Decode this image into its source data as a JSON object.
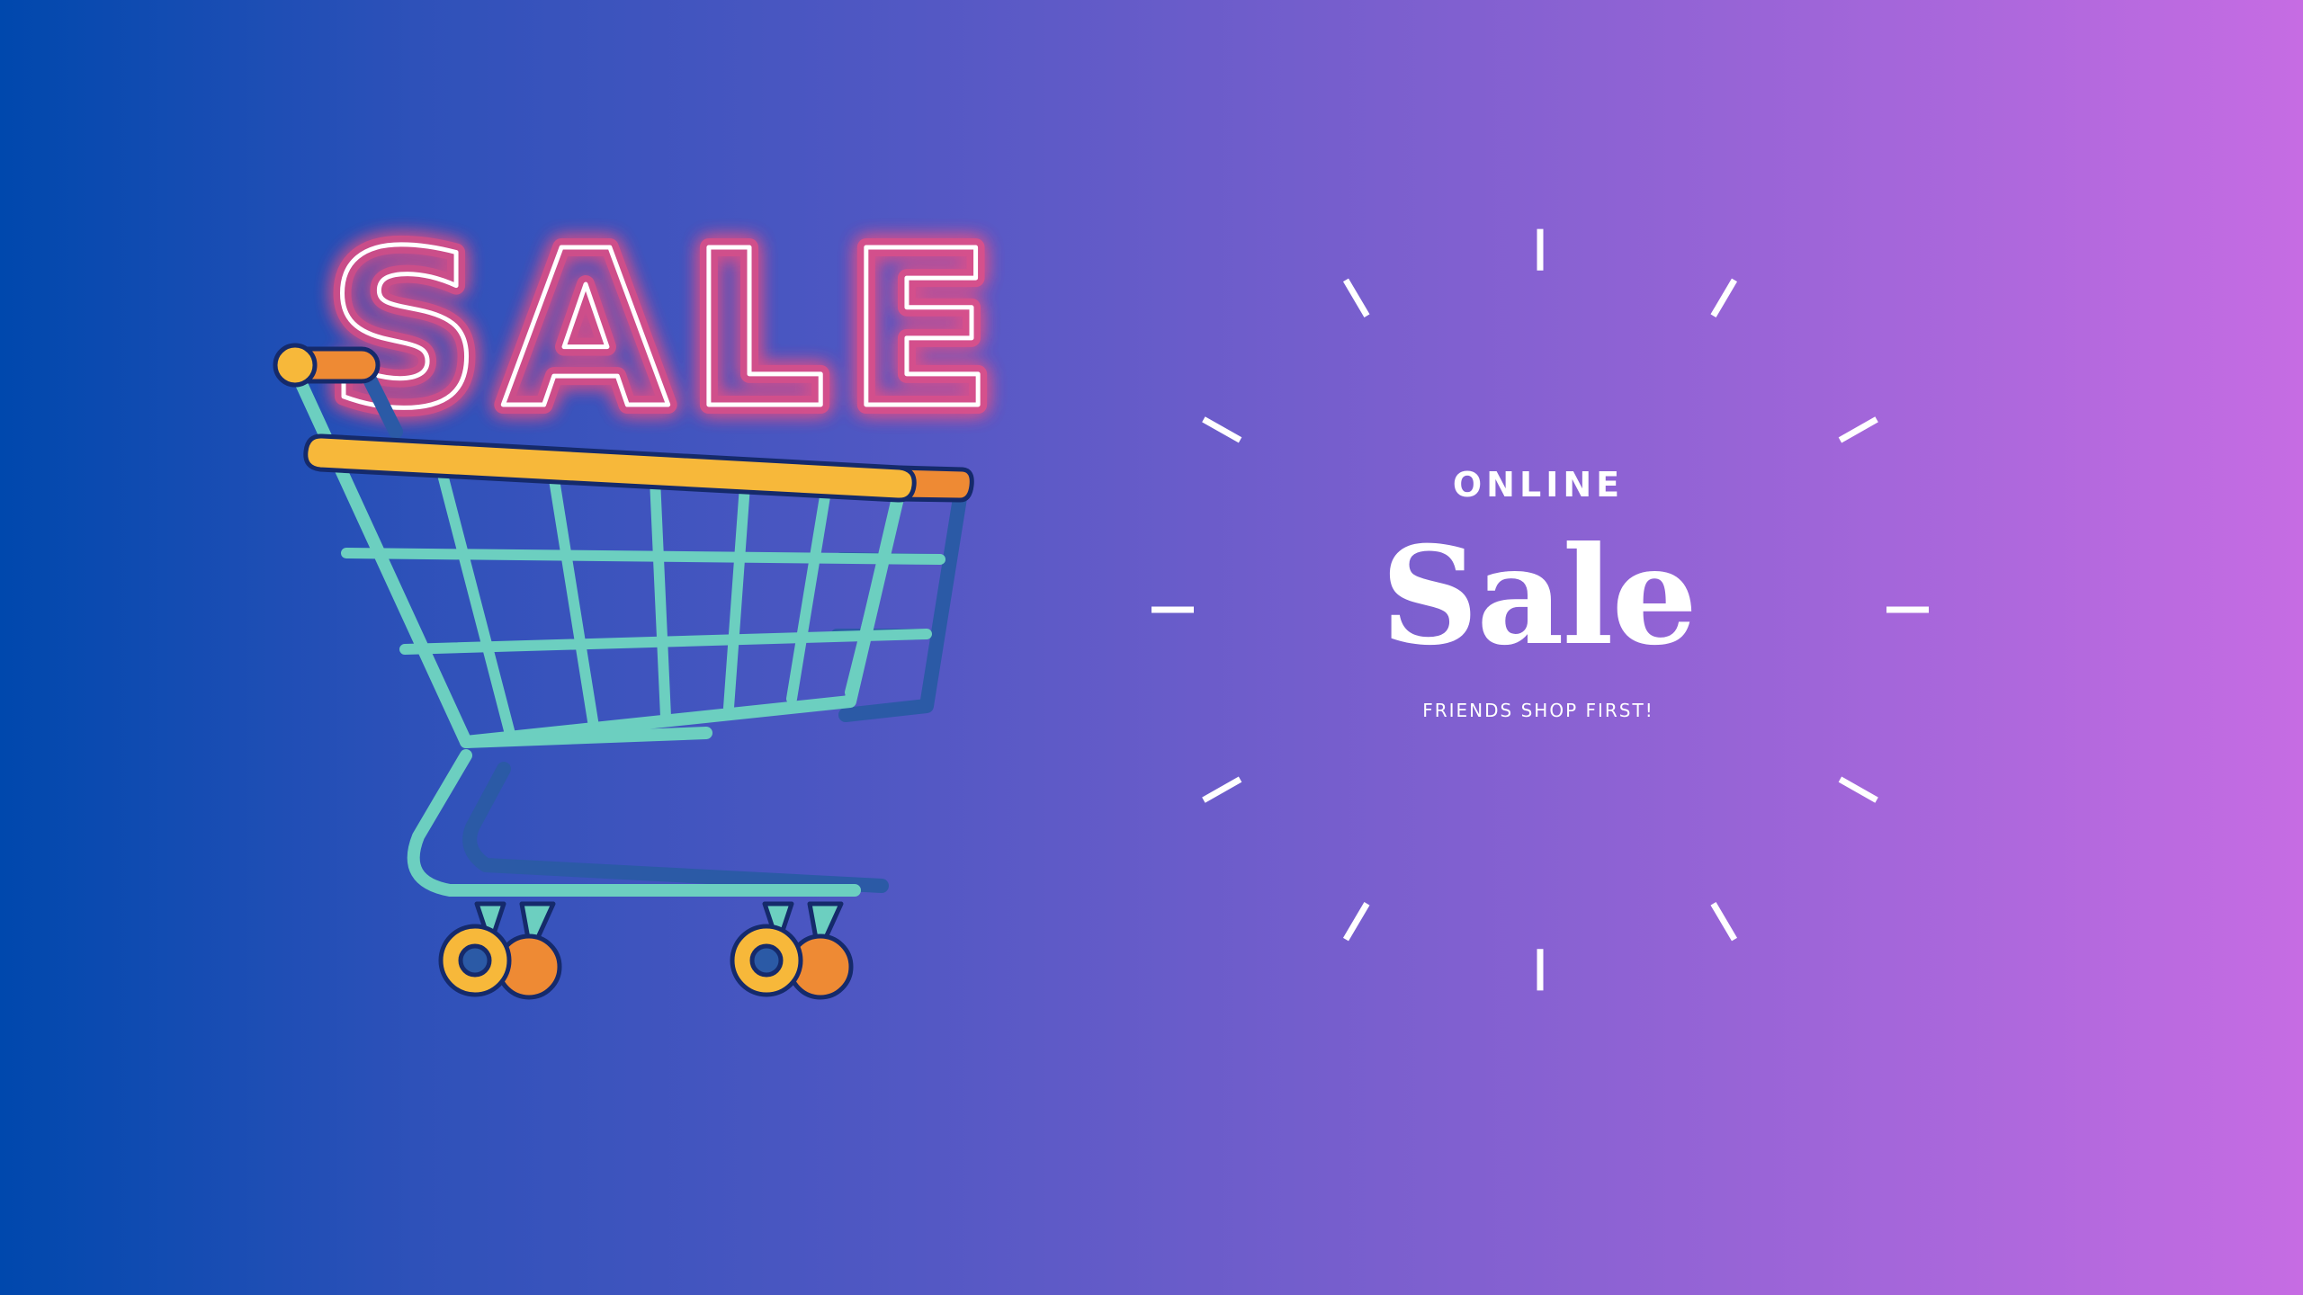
{
  "sign": {
    "text": "SALE"
  },
  "promo": {
    "kicker": "ONLINE",
    "title": "Sale",
    "tagline": "FRIENDS SHOP FIRST!"
  },
  "colors": {
    "gradient_start": "#0048ad",
    "gradient_end": "#c66ce3",
    "neon_glow": "#ff4d7a",
    "cart_frame": "#6ccfc0",
    "cart_handle": "#f7b83a",
    "cart_handle_end": "#ee8a34",
    "wheel_outer": "#f7b83a",
    "outline": "#152a6b"
  },
  "icons": {
    "cart": "shopping-cart-icon",
    "burst": "sunburst-rays"
  }
}
